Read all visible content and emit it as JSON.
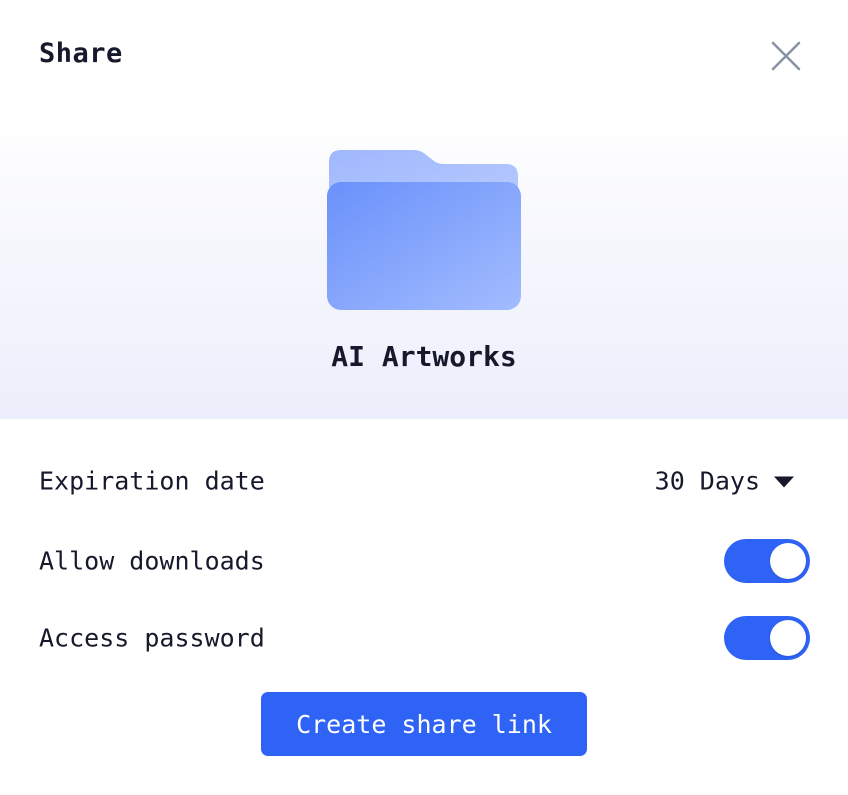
{
  "dialog": {
    "title": "Share",
    "close_icon": "close-icon"
  },
  "item": {
    "icon": "folder-icon",
    "name": "AI Artworks"
  },
  "settings": {
    "expiration": {
      "label": "Expiration date",
      "value": "30 Days",
      "icon": "caret-down-icon"
    },
    "downloads": {
      "label": "Allow downloads",
      "enabled": true
    },
    "password": {
      "label": "Access password",
      "enabled": true
    }
  },
  "actions": {
    "create_label": "Create share link"
  },
  "colors": {
    "accent": "#2f63f5",
    "text": "#16192b",
    "folder_front": "#6f96fc",
    "folder_back": "#a9c1fd",
    "close_icon": "#8a94a6"
  }
}
